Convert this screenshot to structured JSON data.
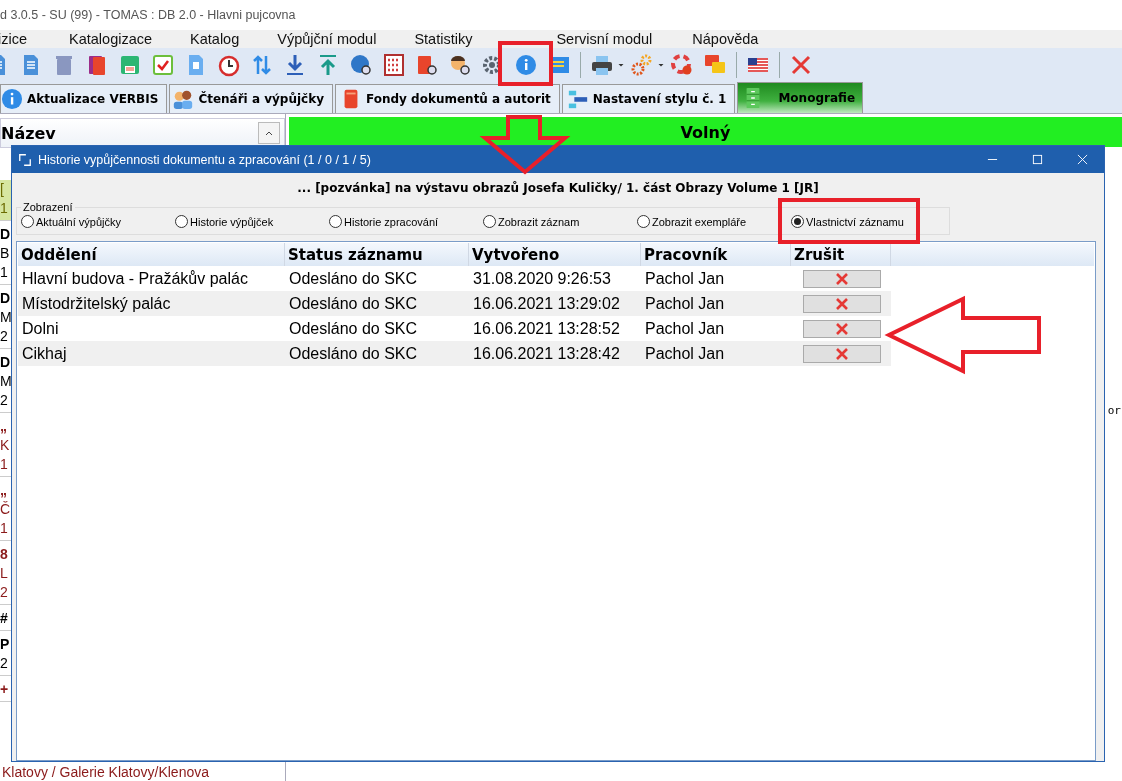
{
  "window": {
    "title": "d 3.0.5 - SU (99) - TOMAS : DB 2.0 - Hlavni pujcovna"
  },
  "menu": [
    "izice",
    "Katalogizace",
    "Katalog",
    "Výpůjční modul",
    "Statistiky",
    "Servisní modul",
    "Nápověda"
  ],
  "tabs": [
    {
      "label": "Aktualizace VERBIS",
      "selected": false
    },
    {
      "label": "Čtenáři a výpůjčky",
      "selected": false
    },
    {
      "label": "Fondy dokumentů a autorit",
      "selected": false
    },
    {
      "label": "Nastavení stylu č. 1",
      "selected": false
    },
    {
      "label": "Monografie",
      "selected": true
    }
  ],
  "left_panel": {
    "header": "Název",
    "fragments": [
      {
        "kind": "highlight",
        "lines": [
          "[",
          "1"
        ]
      },
      {
        "kind": "plain",
        "lines": [
          "D",
          "B",
          "1"
        ]
      },
      {
        "kind": "plain",
        "lines": [
          "D",
          "M",
          "2"
        ]
      },
      {
        "kind": "plain",
        "lines": [
          "D",
          "M",
          "2"
        ]
      },
      {
        "kind": "red",
        "lines": [
          "„",
          "K",
          "1"
        ]
      },
      {
        "kind": "red",
        "lines": [
          "„",
          "Č",
          "1"
        ]
      },
      {
        "kind": "red",
        "lines": [
          "8",
          "L",
          "2"
        ]
      },
      {
        "kind": "plain",
        "lines": [
          "#"
        ]
      },
      {
        "kind": "plain",
        "lines": [
          "P",
          "2"
        ]
      },
      {
        "kind": "red",
        "lines": [
          "+"
        ]
      }
    ],
    "footer": "Klatovy / Galerie Klatovy/Klenova"
  },
  "status_banner": "Volný",
  "right_fragment": "or",
  "dialog": {
    "title": "Historie vypůjčennosti dokumentu a zpracování (1 / 0 / 1 / 5)",
    "subtitle": "... [pozvánka] na výstavu obrazů Josefa Kuličky/ 1. část Obrazy Volume 1 [JR]",
    "group_label": "Zobrazení",
    "options": [
      {
        "label": "Aktuální výpůjčky",
        "selected": false
      },
      {
        "label": "Historie výpůjček",
        "selected": false
      },
      {
        "label": "Historie zpracování",
        "selected": false
      },
      {
        "label": "Zobrazit záznam",
        "selected": false
      },
      {
        "label": "Zobrazit exempláře",
        "selected": false
      },
      {
        "label": "Vlastnictví záznamu",
        "selected": true
      }
    ],
    "table": {
      "columns": [
        "Oddělení",
        "Status záznamu",
        "Vytvořeno",
        "Pracovník",
        "Zrušit"
      ],
      "rows": [
        [
          "Hlavní budova - Pražákův palác",
          "Odesláno do SKC",
          "31.08.2020 9:26:53",
          "Pachol Jan"
        ],
        [
          "Místodržitelský palác",
          "Odesláno do SKC",
          "16.06.2021 13:29:02",
          "Pachol Jan"
        ],
        [
          "Dolni",
          "Odesláno do SKC",
          "16.06.2021 13:28:52",
          "Pachol Jan"
        ],
        [
          "Cikhaj",
          "Odesláno do SKC",
          "16.06.2021 13:28:42",
          "Pachol Jan"
        ]
      ]
    }
  }
}
